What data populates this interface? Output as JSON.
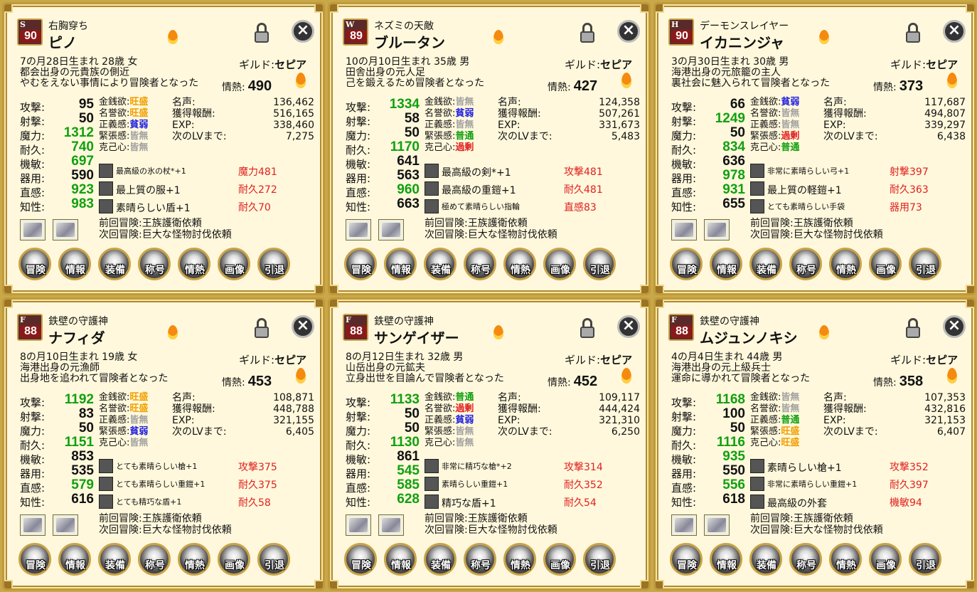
{
  "colors": {
    "bonus": "#e02020",
    "high": "#10a010",
    "trait_strong": "#f0a000",
    "trait_weak": "#2020e0",
    "trait_none": "#a0a0a0",
    "trait_excess": "#e02020",
    "trait_normal": "#10a010"
  },
  "labels": {
    "guild": "ギルド:",
    "passion": "情熱:",
    "stats": [
      "攻撃:",
      "射撃:",
      "魔力:",
      "耐久:",
      "機敏:",
      "器用:",
      "直感:",
      "知性:"
    ],
    "traits": [
      "金銭欲:",
      "名誉欲:",
      "正義感:",
      "緊張感:",
      "克己心:"
    ],
    "fame": [
      "名声:",
      "獲得報酬:",
      "EXP:",
      "次のLVまで:"
    ],
    "prev": "前回冒険:",
    "next": "次回冒険:",
    "buttons": [
      "冒険",
      "情報",
      "装備",
      "称号",
      "情熱",
      "画像",
      "引退"
    ],
    "close": "×"
  },
  "icons": {
    "fire": "fire-icon",
    "lock": "unlock-icon",
    "close": "close-icon"
  },
  "cards": [
    {
      "cls": "S",
      "level": "90",
      "title": "右胸穿ち",
      "name": "ピノ",
      "bio1": "7の月28日生まれ 28歳 女",
      "bio2": "都会出身の元貴族の側近",
      "bio3": "やむをえない事情により冒険者となった",
      "guild": "セピア",
      "passion": "490",
      "stats": [
        "95",
        "50",
        "1312",
        "740",
        "697",
        "590",
        "923",
        "983"
      ],
      "statColor": [
        "",
        "",
        "g",
        "g",
        "g",
        "",
        "g",
        "g"
      ],
      "traits": [
        "旺盛",
        "旺盛",
        "貧弱",
        "皆無",
        "皆無"
      ],
      "traitColor": [
        "yellow",
        "yellow",
        "blue",
        "gray",
        "gray"
      ],
      "fame": [
        "136,462",
        "516,165",
        "338,460",
        "7,275"
      ],
      "equips": [
        {
          "n": "最高級の氷の杖*+1",
          "s": true,
          "b": "魔力481"
        },
        {
          "n": "最上質の服+1",
          "s": false,
          "b": "耐久272"
        },
        {
          "n": "素晴らしい盾+1",
          "s": false,
          "b": "耐久70"
        }
      ],
      "prev": "王族護衛依頼",
      "next": "巨大な怪物討伐依頼"
    },
    {
      "cls": "W",
      "level": "89",
      "title": "ネズミの天敵",
      "name": "ブルータン",
      "bio1": "10の月10日生まれ 35歳 男",
      "bio2": "田舎出身の元人足",
      "bio3": "己を鍛えるため冒険者となった",
      "guild": "セピア",
      "passion": "427",
      "stats": [
        "1334",
        "58",
        "50",
        "1170",
        "641",
        "563",
        "960",
        "663"
      ],
      "statColor": [
        "g",
        "",
        "",
        "g",
        "",
        "",
        "g",
        ""
      ],
      "traits": [
        "皆無",
        "貧弱",
        "皆無",
        "普通",
        "過剰"
      ],
      "traitColor": [
        "gray",
        "blue",
        "gray",
        "green",
        "red"
      ],
      "fame": [
        "124,358",
        "507,261",
        "331,673",
        "5,483"
      ],
      "equips": [
        {
          "n": "最高級の剣*+1",
          "s": false,
          "b": "攻撃481"
        },
        {
          "n": "最高級の重鎧+1",
          "s": false,
          "b": "耐久481"
        },
        {
          "n": "極めて素晴らしい指輪",
          "s": true,
          "b": "直感83"
        }
      ],
      "prev": "王族護衛依頼",
      "next": "巨大な怪物討伐依頼"
    },
    {
      "cls": "H",
      "level": "90",
      "title": "デーモンスレイヤー",
      "name": "イカニンジャ",
      "bio1": "3の月30日生まれ 30歳 男",
      "bio2": "海港出身の元旅籠の主人",
      "bio3": "裏社会に魅入られて冒険者となった",
      "guild": "セピア",
      "passion": "373",
      "stats": [
        "66",
        "1249",
        "50",
        "834",
        "636",
        "978",
        "931",
        "655"
      ],
      "statColor": [
        "",
        "g",
        "",
        "g",
        "",
        "g",
        "g",
        ""
      ],
      "traits": [
        "貧弱",
        "皆無",
        "皆無",
        "過剰",
        "普通"
      ],
      "traitColor": [
        "blue",
        "gray",
        "gray",
        "red",
        "green"
      ],
      "fame": [
        "117,687",
        "494,807",
        "339,297",
        "6,438"
      ],
      "equips": [
        {
          "n": "非常に素晴らしい弓+1",
          "s": true,
          "b": "射撃397"
        },
        {
          "n": "最上質の軽鎧+1",
          "s": false,
          "b": "耐久363"
        },
        {
          "n": "とても素晴らしい手袋",
          "s": true,
          "b": "器用73"
        }
      ],
      "prev": "王族護衛依頼",
      "next": "巨大な怪物討伐依頼"
    },
    {
      "cls": "F",
      "level": "88",
      "title": "鉄壁の守護神",
      "name": "ナフィダ",
      "bio1": "8の月10日生まれ 19歳 女",
      "bio2": "海港出身の元漁師",
      "bio3": "出身地を追われて冒険者となった",
      "guild": "セピア",
      "passion": "453",
      "stats": [
        "1192",
        "83",
        "50",
        "1151",
        "853",
        "535",
        "579",
        "616"
      ],
      "statColor": [
        "g",
        "",
        "",
        "g",
        "",
        "",
        "g",
        ""
      ],
      "traits": [
        "旺盛",
        "旺盛",
        "皆無",
        "貧弱",
        "皆無"
      ],
      "traitColor": [
        "yellow",
        "yellow",
        "gray",
        "blue",
        "gray"
      ],
      "fame": [
        "108,871",
        "448,788",
        "321,155",
        "6,405"
      ],
      "equips": [
        {
          "n": "とても素晴らしい槍+1",
          "s": true,
          "b": "攻撃375"
        },
        {
          "n": "とても素晴らしい重鎧+1",
          "s": true,
          "b": "耐久375"
        },
        {
          "n": "とても精巧な盾+1",
          "s": true,
          "b": "耐久58"
        }
      ],
      "prev": "王族護衛依頼",
      "next": "巨大な怪物討伐依頼"
    },
    {
      "cls": "F",
      "level": "88",
      "title": "鉄壁の守護神",
      "name": "サンゲイザー",
      "bio1": "8の月12日生まれ 32歳 男",
      "bio2": "山岳出身の元鉱夫",
      "bio3": "立身出世を目論んで冒険者となった",
      "guild": "セピア",
      "passion": "452",
      "stats": [
        "1133",
        "50",
        "50",
        "1130",
        "861",
        "545",
        "585",
        "628"
      ],
      "statColor": [
        "g",
        "",
        "",
        "g",
        "",
        "g",
        "g",
        "g"
      ],
      "traits": [
        "普通",
        "過剰",
        "貧弱",
        "皆無",
        "皆無"
      ],
      "traitColor": [
        "green",
        "red",
        "blue",
        "gray",
        "gray"
      ],
      "fame": [
        "109,117",
        "444,424",
        "321,310",
        "6,250"
      ],
      "equips": [
        {
          "n": "非常に精巧な槍*+2",
          "s": true,
          "b": "攻撃314"
        },
        {
          "n": "素晴らしい重鎧+1",
          "s": true,
          "b": "耐久352"
        },
        {
          "n": "精巧な盾+1",
          "s": false,
          "b": "耐久54"
        }
      ],
      "prev": "王族護衛依頼",
      "next": "巨大な怪物討伐依頼"
    },
    {
      "cls": "F",
      "level": "88",
      "title": "鉄壁の守護神",
      "name": "ムジュンノキシ",
      "bio1": "4の月4日生まれ 44歳 男",
      "bio2": "海港出身の元上級兵士",
      "bio3": "運命に導かれて冒険者となった",
      "guild": "セピア",
      "passion": "358",
      "stats": [
        "1168",
        "100",
        "50",
        "1116",
        "935",
        "550",
        "556",
        "618"
      ],
      "statColor": [
        "g",
        "",
        "",
        "g",
        "g",
        "",
        "g",
        ""
      ],
      "traits": [
        "皆無",
        "皆無",
        "普通",
        "旺盛",
        "旺盛"
      ],
      "traitColor": [
        "gray",
        "gray",
        "green",
        "yellow",
        "yellow"
      ],
      "fame": [
        "107,353",
        "432,816",
        "321,153",
        "6,407"
      ],
      "equips": [
        {
          "n": "素晴らしい槍+1",
          "s": false,
          "b": "攻撃352"
        },
        {
          "n": "非常に素晴らしい重鎧+1",
          "s": true,
          "b": "耐久397"
        },
        {
          "n": "最高級の外套",
          "s": false,
          "b": "機敏94"
        }
      ],
      "prev": "王族護衛依頼",
      "next": "巨大な怪物討伐依頼"
    }
  ]
}
